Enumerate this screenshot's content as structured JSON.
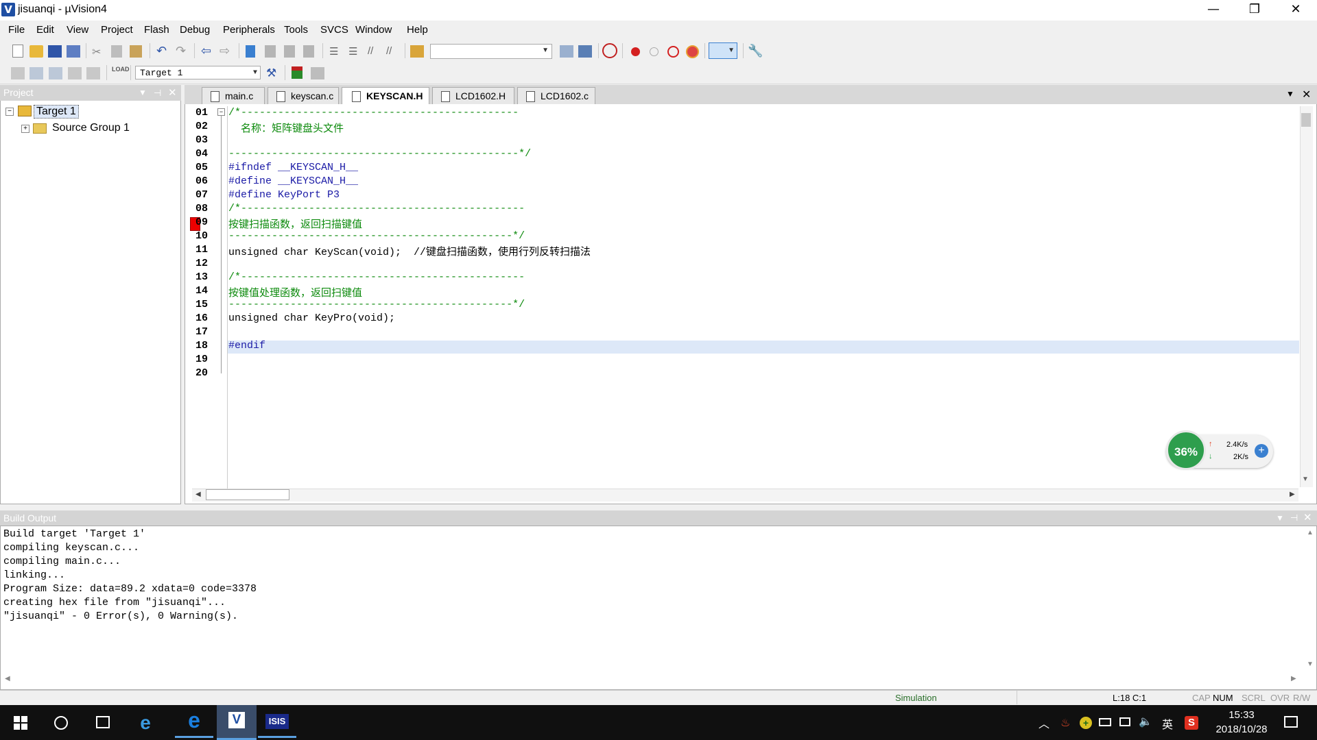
{
  "window": {
    "title": "jisuanqi  - µVision4",
    "app_icon": "V",
    "minimize": "—",
    "maximize": "❐",
    "close": "✕"
  },
  "menu": [
    "File",
    "Edit",
    "View",
    "Project",
    "Flash",
    "Debug",
    "Peripherals",
    "Tools",
    "SVCS",
    "Window",
    "Help"
  ],
  "toolbar": {
    "target": "Target 1",
    "search_value": ""
  },
  "project": {
    "header": "Project",
    "root": "Target 1",
    "child": "Source Group 1"
  },
  "tabs": [
    {
      "label": "main.c",
      "active": false
    },
    {
      "label": "keyscan.c",
      "active": false
    },
    {
      "label": "KEYSCAN.H",
      "active": true
    },
    {
      "label": "LCD1602.H",
      "active": false
    },
    {
      "label": "LCD1602.c",
      "active": false
    }
  ],
  "editor": {
    "line_numbers": [
      "01",
      "02",
      "03",
      "04",
      "05",
      "06",
      "07",
      "08",
      "09",
      "10",
      "11",
      "12",
      "13",
      "14",
      "15",
      "16",
      "17",
      "18",
      "19",
      "20"
    ],
    "lines": [
      "/*---------------------------------------------",
      "  名称：矩阵键盘头文件",
      "",
      "-----------------------------------------------*/",
      "#ifndef __KEYSCAN_H__",
      "#define __KEYSCAN_H__",
      "#define KeyPort P3",
      "/*----------------------------------------------",
      "按键扫描函数，返回扫描键值",
      "----------------------------------------------*/",
      "unsigned char KeyScan(void);  //键盘扫描函数，使用行列反转扫描法",
      "",
      "/*----------------------------------------------",
      "按键值处理函数，返回扫键值",
      "----------------------------------------------*/",
      "unsigned char KeyPro(void);",
      "",
      "#endif",
      "",
      ""
    ]
  },
  "output": {
    "header": "Build Output",
    "lines": [
      "Build target 'Target 1'",
      "compiling keyscan.c...",
      "compiling main.c...",
      "linking...",
      "Program Size: data=89.2 xdata=0 code=3378",
      "creating hex file from \"jisuanqi\"...",
      "\"jisuanqi\" - 0 Error(s), 0 Warning(s)."
    ]
  },
  "status": {
    "mode": "Simulation",
    "position": "L:18 C:1",
    "cap": "CAP",
    "num": "NUM",
    "scrl": "SCRL",
    "ovr": "OVR",
    "rw": "R/W"
  },
  "net_widget": {
    "percent": "36%",
    "up": "2.4K/s",
    "down": "2K/s"
  },
  "taskbar": {
    "time": "15:33",
    "date": "2018/10/28",
    "ime": "英",
    "isis": "ISIS"
  },
  "colors": {
    "comment_green": "#0c8a0c",
    "keyword_blue": "#1a1aa6",
    "line_comment": "#1f8faf",
    "current_line": "#dde8f8",
    "breakpoint": "#e00000"
  }
}
